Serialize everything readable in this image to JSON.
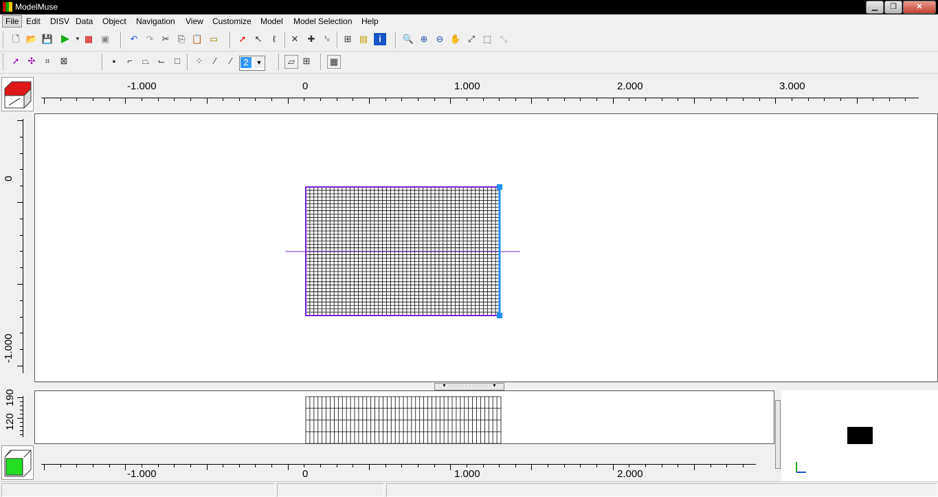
{
  "window": {
    "title": "ModelMuse"
  },
  "menu": {
    "items": [
      "File",
      "Edit",
      "DISV",
      "Data",
      "Object",
      "Navigation",
      "View",
      "Customize",
      "Model",
      "Model Selection",
      "Help"
    ]
  },
  "toolbar": {
    "cell_selector_value": "2"
  },
  "top_view": {
    "x_ruler_labels": [
      "-1.000",
      "0",
      "1.000",
      "2.000",
      "3.000"
    ],
    "y_ruler_labels": [
      "0",
      "-1.000"
    ]
  },
  "front_view": {
    "x_ruler_labels": [
      "-1.000",
      "0",
      "1.000",
      "2.000"
    ],
    "z_ruler_labels": [
      "120",
      "190"
    ]
  },
  "colors": {
    "grid_line": "#000000",
    "grid_outline": "#7a1fd6",
    "selection_handle": "#1e90ff",
    "cube_top": "#e01818",
    "cube_front": "#22dd22"
  }
}
